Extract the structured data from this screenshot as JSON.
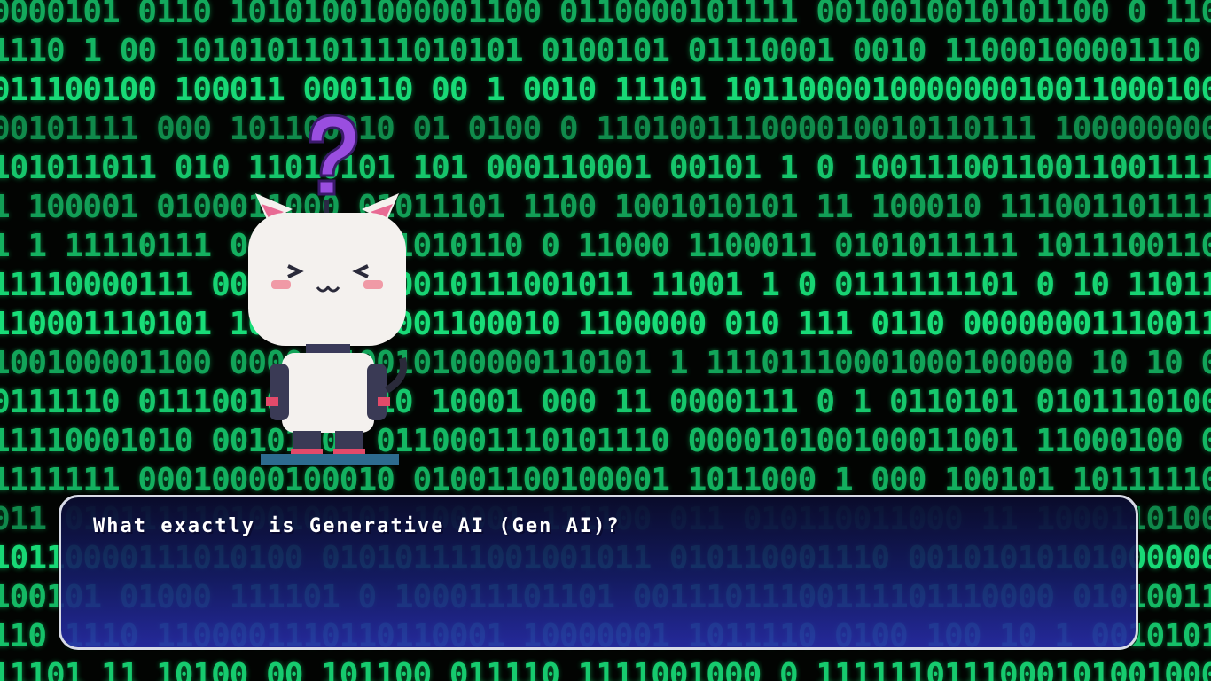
{
  "scene": {
    "background": "binary-code-matrix",
    "accent_color": "#19e07a",
    "character": "white-pixel-cat-robot",
    "character_emote": "purple-question-mark"
  },
  "dialog": {
    "text": "What exactly is Generative AI (Gen AI)?"
  },
  "colors": {
    "dialog_top": "#0a0c2d",
    "dialog_bottom": "#282daa",
    "dialog_border": "#d8dbe6",
    "question_mark": "#9a4ee0"
  }
}
